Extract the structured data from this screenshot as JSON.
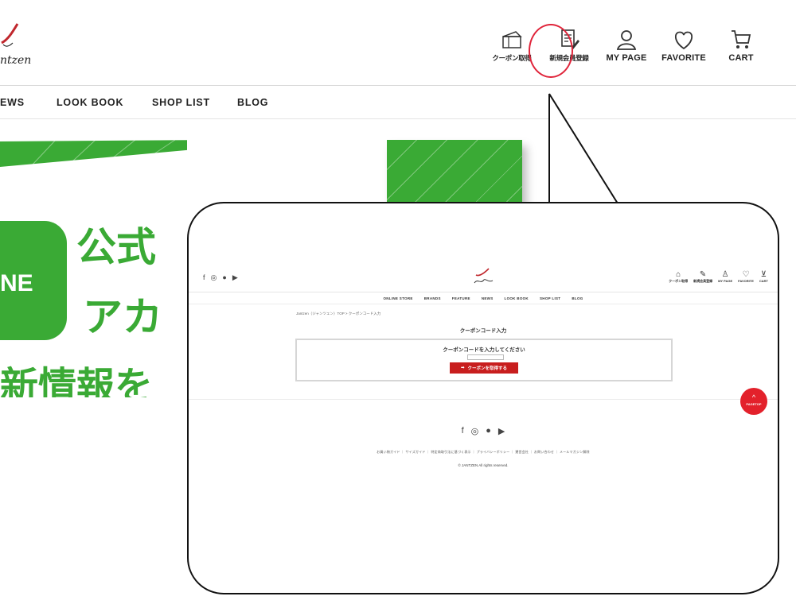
{
  "header": {
    "logo_text": "ntzen",
    "icons": [
      {
        "label": "クーポン取得",
        "icon": "coupon-icon"
      },
      {
        "label": "新規会員登録",
        "icon": "register-icon"
      },
      {
        "label": "MY PAGE",
        "icon": "user-icon"
      },
      {
        "label": "FAVORITE",
        "icon": "heart-icon"
      },
      {
        "label": "CART",
        "icon": "cart-icon"
      }
    ],
    "highlight_color": "#e0243a"
  },
  "nav": {
    "items": [
      "EWS",
      "LOOK BOOK",
      "SHOP LIST",
      "BLOG"
    ]
  },
  "banner": {
    "accent_color": "#3aaa35",
    "badge_text": "NE",
    "line1": "公式",
    "line2": "アカ",
    "line3": "新情報を"
  },
  "bubble": {
    "social_icons": [
      "f",
      "◎",
      "●",
      "▶"
    ],
    "mini_icons": [
      {
        "glyph": "⌂",
        "label": "クーポン取得"
      },
      {
        "glyph": "✎",
        "label": "新規会員登録"
      },
      {
        "glyph": "♙",
        "label": "MY PAGE"
      },
      {
        "glyph": "♡",
        "label": "FAVORITE"
      },
      {
        "glyph": "⊻",
        "label": "CART"
      }
    ],
    "nav": [
      "ONLINE STORE",
      "BRANDS",
      "FEATURE",
      "NEWS",
      "LOOK BOOK",
      "SHOP LIST",
      "BLOG"
    ],
    "breadcrumb": "Jantzen（ジャンツェン）TOP > クーポンコード入力",
    "title": "クーポンコード入力",
    "prompt": "クーポンコードを入力してください",
    "button_label": "クーポンを取得する",
    "button_color": "#c81e1e",
    "pagetop_label": "PAGETOP",
    "pagetop_color": "#e3212b",
    "footer_links": "お買い物ガイド ｜ サイズガイド ｜ 特定商取引法に基づく表示 ｜ プライバシーポリシー ｜ 運営会社 ｜ お問い合わせ ｜ メールマガジン解除",
    "copyright": "© JANTZEN All rights reserved."
  }
}
